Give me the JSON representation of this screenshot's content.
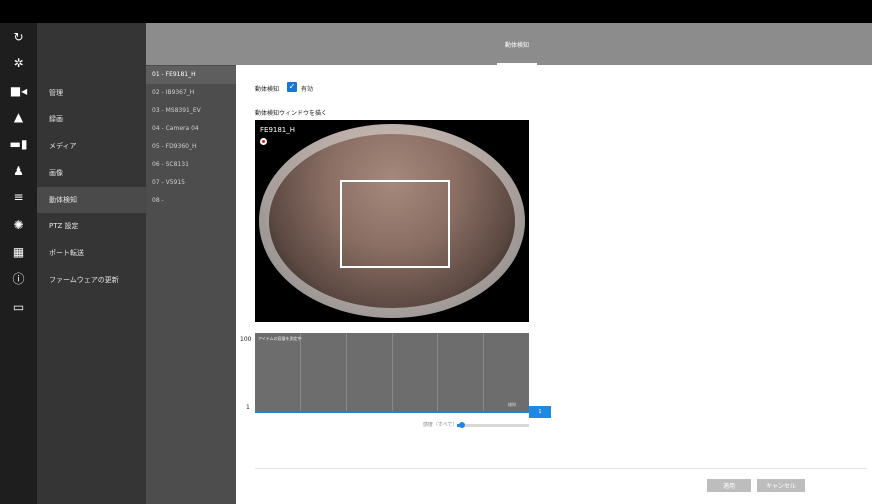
{
  "header": {
    "active_tab": "動体検知"
  },
  "nav": {
    "items": [
      {
        "label": "管理"
      },
      {
        "label": "録画"
      },
      {
        "label": "メディア"
      },
      {
        "label": "画像"
      },
      {
        "label": "動体検知"
      },
      {
        "label": "PTZ 設定"
      },
      {
        "label": "ポート転送"
      },
      {
        "label": "ファームウェアの更新"
      }
    ],
    "active_index": 4
  },
  "cameras": {
    "items": [
      {
        "label": "01 - FE9181_H"
      },
      {
        "label": "02 - IB9367_H"
      },
      {
        "label": "03 - MS8391_EV"
      },
      {
        "label": "04 - Camera 04"
      },
      {
        "label": "05 - FD9360_H"
      },
      {
        "label": "06 - SC8131"
      },
      {
        "label": "07 - V5915"
      },
      {
        "label": "08 -"
      }
    ],
    "active_index": 0
  },
  "motion": {
    "label": "動体検知",
    "enabled_label": "有効",
    "enabled": true,
    "draw_window_label": "動体検知ウィンドウを描く",
    "preview_camera_name": "FE9181_H"
  },
  "graph": {
    "y_max_label": "100",
    "y_min_label": "1",
    "title": "アイテムの容量を測定中",
    "level_text": "検知",
    "value_box": "1",
    "sensitivity_label": "感度（すべて）",
    "sensitivity_value": 0.05
  },
  "footer": {
    "apply_label": "適用",
    "cancel_label": "キャンセル"
  },
  "colors": {
    "accent": "#1e88e5",
    "nav_bg": "#353535",
    "cam_bg": "#4d4d4d",
    "header_bg": "#8c8c8c"
  }
}
